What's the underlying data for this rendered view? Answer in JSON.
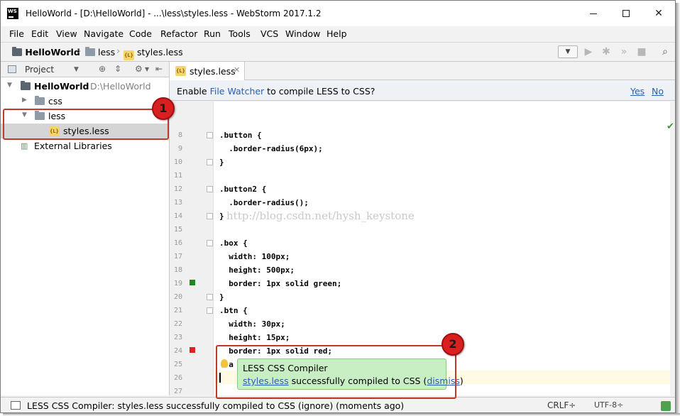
{
  "window": {
    "icon_text": "WS",
    "title": "HelloWorld - [D:\\HelloWorld] - ...\\less\\styles.less - WebStorm 2017.1.2"
  },
  "menu": [
    "File",
    "Edit",
    "View",
    "Navigate",
    "Code",
    "Refactor",
    "Run",
    "Tools",
    "VCS",
    "Window",
    "Help"
  ],
  "navbar": {
    "crumbs": [
      "HelloWorld",
      "less",
      "styles.less"
    ]
  },
  "project_panel": {
    "header": "Project",
    "tree": [
      {
        "label": "HelloWorld",
        "path": "D:\\HelloWorld",
        "expanded": true
      },
      {
        "label": "css",
        "expanded": false
      },
      {
        "label": "less",
        "expanded": true
      },
      {
        "label": "styles.less",
        "selected": true
      },
      {
        "label": "External Libraries"
      }
    ]
  },
  "editor_tab": {
    "label": "styles.less"
  },
  "file_watcher_banner": {
    "prefix": "Enable ",
    "link": "File Watcher",
    "suffix": " to compile LESS to CSS?",
    "yes": "Yes",
    "no": "No"
  },
  "code": {
    "lines": [
      {
        "num": "8",
        "text": ".button {"
      },
      {
        "num": "9",
        "text": "  .border-radius(6px);"
      },
      {
        "num": "10",
        "text": "}"
      },
      {
        "num": "11",
        "text": ""
      },
      {
        "num": "12",
        "text": ".button2 {"
      },
      {
        "num": "13",
        "text": "  .border-radius();"
      },
      {
        "num": "14",
        "text": "}"
      },
      {
        "num": "15",
        "text": ""
      },
      {
        "num": "16",
        "text": ".box {"
      },
      {
        "num": "17",
        "text": "  width: 100px;"
      },
      {
        "num": "18",
        "text": "  height: 500px;"
      },
      {
        "num": "19",
        "text": "  border: 1px solid green;"
      },
      {
        "num": "20",
        "text": "}"
      },
      {
        "num": "21",
        "text": ".btn {"
      },
      {
        "num": "22",
        "text": "  width: 30px;"
      },
      {
        "num": "23",
        "text": "  height: 15px;"
      },
      {
        "num": "24",
        "text": "  border: 1px solid red;"
      },
      {
        "num": "25",
        "text": "  a"
      },
      {
        "num": "26",
        "text": ""
      },
      {
        "num": "27",
        "text": ""
      }
    ],
    "watermark": "http://blog.csdn.net/hysh_keystone",
    "swatch_green": "#1e8a1e",
    "swatch_red": "#dd2222"
  },
  "balloon": {
    "title": "LESS CSS Compiler",
    "file_link": "styles.less",
    "message": " successfully compiled to CSS (",
    "dismiss": "dismiss",
    "close_paren": ")"
  },
  "callouts": [
    "1",
    "2"
  ],
  "statusbar": {
    "text": "LESS CSS Compiler: styles.less successfully compiled to CSS (ignore) (moments ago)",
    "line_sep": "CRLF÷",
    "encoding": "UTF-8÷"
  },
  "colors": {
    "accent_red": "#d91f1f",
    "balloon_bg": "#c8eec3",
    "link": "#2a5fb0"
  }
}
